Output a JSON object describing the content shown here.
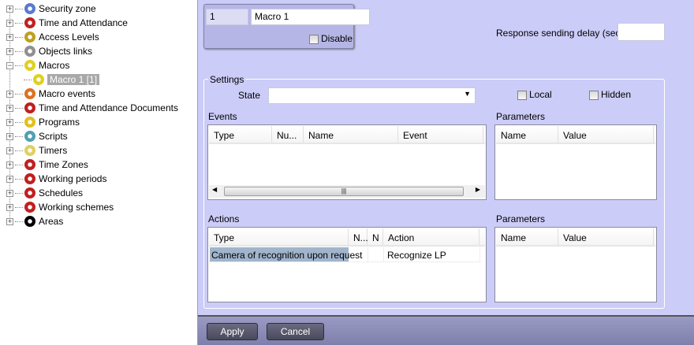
{
  "tree": {
    "items": [
      {
        "label": "Security zone",
        "icon": "security-zone-icon",
        "expander": "+",
        "color": "#5a7ad0"
      },
      {
        "label": "Time and Attendance",
        "icon": "clock-icon",
        "expander": "+",
        "color": "#c02020"
      },
      {
        "label": "Access Levels",
        "icon": "keys-icon",
        "expander": "+",
        "color": "#c0a020"
      },
      {
        "label": "Objects links",
        "icon": "link-icon",
        "expander": "+",
        "color": "#909090"
      },
      {
        "label": "Macros",
        "icon": "gear-icon",
        "expander": "-",
        "color": "#e0d020"
      },
      {
        "label": "Macro 1 [1]",
        "icon": "gear-icon",
        "expander": "",
        "color": "#e0d020",
        "selected": true
      },
      {
        "label": "Macro events",
        "icon": "macro-events-icon",
        "expander": "+",
        "color": "#e07020"
      },
      {
        "label": "Time and Attendance Documents",
        "icon": "clock-icon",
        "expander": "+",
        "color": "#c02020"
      },
      {
        "label": "Programs",
        "icon": "programs-icon",
        "expander": "+",
        "color": "#e0c020"
      },
      {
        "label": "Scripts",
        "icon": "script-icon",
        "expander": "+",
        "color": "#50a0b0"
      },
      {
        "label": "Timers",
        "icon": "timer-icon",
        "expander": "+",
        "color": "#e0d060"
      },
      {
        "label": "Time Zones",
        "icon": "clock-icon",
        "expander": "+",
        "color": "#c02020"
      },
      {
        "label": "Working periods",
        "icon": "clock-icon",
        "expander": "+",
        "color": "#c02020"
      },
      {
        "label": "Schedules",
        "icon": "clock-icon",
        "expander": "+",
        "color": "#c02020"
      },
      {
        "label": "Working schemes",
        "icon": "clock-icon",
        "expander": "+",
        "color": "#c02020"
      },
      {
        "label": "Areas",
        "icon": "home-icon",
        "expander": "+",
        "color": "#000000"
      }
    ]
  },
  "object": {
    "id": "1",
    "name": "Macro 1",
    "disable_label": "Disable"
  },
  "delay": {
    "label": "Response sending delay (sec):",
    "value": ""
  },
  "settings": {
    "title": "Settings",
    "state_label": "State",
    "state_value": "",
    "local_label": "Local",
    "hidden_label": "Hidden"
  },
  "events": {
    "title": "Events",
    "columns": [
      "Type",
      "Nu...",
      "Name",
      "Event"
    ]
  },
  "event_params": {
    "title": "Parameters",
    "columns": [
      "Name",
      "Value"
    ]
  },
  "actions": {
    "title": "Actions",
    "columns": [
      "Type",
      "N...",
      "N",
      "Action"
    ],
    "rows": [
      [
        "Camera of recognition upon request",
        "",
        "",
        "Recognize LP"
      ]
    ]
  },
  "action_params": {
    "title": "Parameters",
    "columns": [
      "Name",
      "Value"
    ]
  },
  "buttons": {
    "apply": "Apply",
    "cancel": "Cancel"
  }
}
